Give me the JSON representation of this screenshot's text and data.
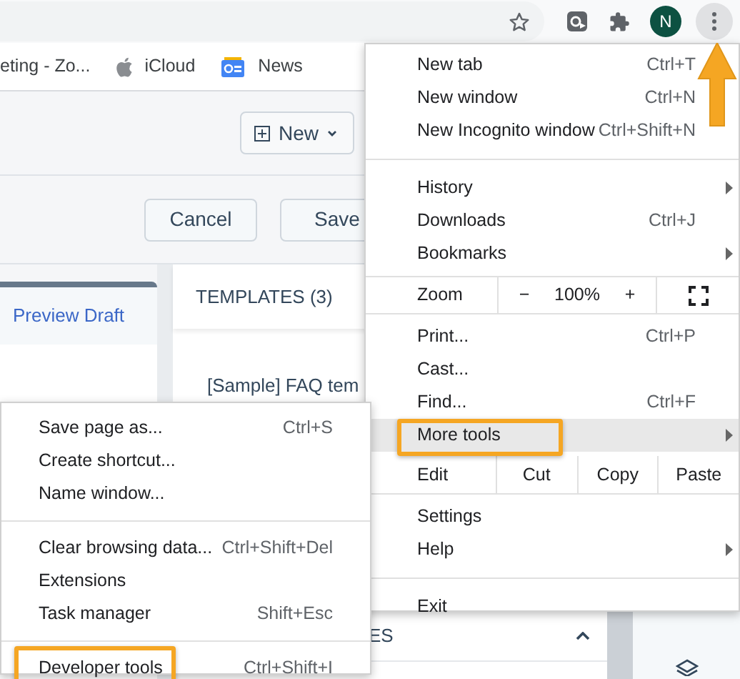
{
  "toolbar": {
    "avatar": "N"
  },
  "bookmarks": [
    {
      "label": "eting - Zo...",
      "kind": "plain"
    },
    {
      "label": "iCloud",
      "kind": "apple"
    },
    {
      "label": "News",
      "kind": "news"
    }
  ],
  "page": {
    "new_button": "New",
    "cancel_button": "Cancel",
    "save_button": "Save",
    "preview_tab": "Preview Draft",
    "templates_heading": "TEMPLATES (3)",
    "template_item": "[Sample] FAQ tem",
    "section_heading": "ES"
  },
  "menu": {
    "items": [
      {
        "kind": "item",
        "label": "New tab",
        "shortcut": "Ctrl+T",
        "submenu": false,
        "highlighted": false,
        "callout": false
      },
      {
        "kind": "item",
        "label": "New window",
        "shortcut": "Ctrl+N",
        "submenu": false,
        "highlighted": false,
        "callout": false
      },
      {
        "kind": "item",
        "label": "New Incognito window",
        "shortcut": "Ctrl+Shift+N",
        "submenu": false,
        "highlighted": false,
        "callout": false
      },
      {
        "kind": "divider"
      },
      {
        "kind": "item",
        "label": "History",
        "submenu": true,
        "highlighted": false,
        "callout": false
      },
      {
        "kind": "item",
        "label": "Downloads",
        "shortcut": "Ctrl+J",
        "submenu": false,
        "highlighted": false,
        "callout": false
      },
      {
        "kind": "item",
        "label": "Bookmarks",
        "submenu": true,
        "highlighted": false,
        "callout": false
      },
      {
        "kind": "zoom",
        "label": "Zoom",
        "minus": "−",
        "reading": "100%",
        "plus": "+"
      },
      {
        "kind": "item",
        "label": "Print...",
        "shortcut": "Ctrl+P",
        "submenu": false,
        "highlighted": false,
        "callout": false
      },
      {
        "kind": "item",
        "label": "Cast...",
        "submenu": false,
        "highlighted": false,
        "callout": false
      },
      {
        "kind": "item",
        "label": "Find...",
        "shortcut": "Ctrl+F",
        "submenu": false,
        "highlighted": false,
        "callout": false
      },
      {
        "kind": "item",
        "label": "More tools",
        "submenu": true,
        "highlighted": true,
        "callout": true
      },
      {
        "kind": "edit",
        "label": "Edit",
        "actions": [
          "Cut",
          "Copy",
          "Paste"
        ]
      },
      {
        "kind": "item",
        "label": "Settings",
        "submenu": false,
        "highlighted": false,
        "callout": false
      },
      {
        "kind": "item",
        "label": "Help",
        "submenu": true,
        "highlighted": false,
        "callout": false
      },
      {
        "kind": "divider"
      },
      {
        "kind": "item",
        "label": "Exit",
        "submenu": false,
        "highlighted": false,
        "callout": false
      }
    ]
  },
  "submenu": {
    "items": [
      {
        "kind": "item",
        "label": "Save page as...",
        "shortcut": "Ctrl+S",
        "callout": false
      },
      {
        "kind": "item",
        "label": "Create shortcut...",
        "callout": false
      },
      {
        "kind": "item",
        "label": "Name window...",
        "callout": false
      },
      {
        "kind": "divider"
      },
      {
        "kind": "item",
        "label": "Clear browsing data...",
        "shortcut": "Ctrl+Shift+Del",
        "callout": false
      },
      {
        "kind": "item",
        "label": "Extensions",
        "callout": false
      },
      {
        "kind": "item",
        "label": "Task manager",
        "shortcut": "Shift+Esc",
        "callout": false
      },
      {
        "kind": "divider"
      },
      {
        "kind": "item",
        "label": "Developer tools",
        "shortcut": "Ctrl+Shift+I",
        "callout": true
      }
    ]
  }
}
